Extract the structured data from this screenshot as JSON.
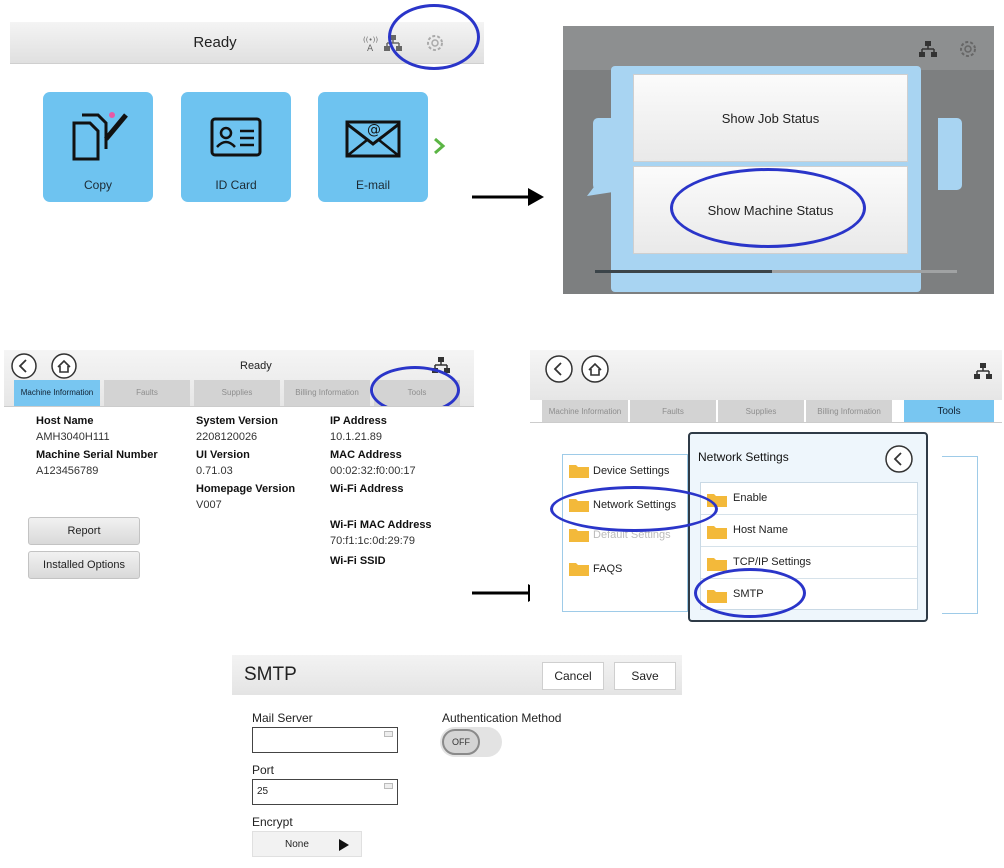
{
  "home": {
    "status": "Ready",
    "tiles": [
      {
        "label": "Copy",
        "icon": "copy-icon"
      },
      {
        "label": "ID Card",
        "icon": "id-card-icon"
      },
      {
        "label": "E-mail",
        "icon": "email-icon"
      }
    ],
    "icons": [
      "wireless-icon",
      "network-icon",
      "settings-gear-icon",
      "chevron-right-icon"
    ]
  },
  "status_menu": {
    "items": [
      "Show Job Status",
      "Show Machine Status"
    ],
    "progress": 0.49
  },
  "machine_info": {
    "status": "Ready",
    "tabs": [
      "Machine Information",
      "Faults",
      "Supplies",
      "Billing Information",
      "Tools"
    ],
    "host_name_label": "Host Name",
    "host_name": "AMH3040H111",
    "serial_label": "Machine Serial Number",
    "serial": "A123456789",
    "system_version_label": "System Version",
    "system_version": "2208120026",
    "ui_version_label": "UI Version",
    "ui_version": "0.71.03",
    "homepage_version_label": "Homepage Version",
    "homepage_version": "V007",
    "ip_label": "IP Address",
    "ip": "10.1.21.89",
    "mac_label": "MAC Address",
    "mac": "00:02:32:f0:00:17",
    "wifi_label": "Wi-Fi Address",
    "wifi_mac_label": "Wi-Fi MAC Address",
    "wifi_mac": "70:f1:1c:0d:29:79",
    "wifi_ssid_label": "Wi-Fi SSID",
    "report_button": "Report",
    "installed_options_button": "Installed Options"
  },
  "tools": {
    "tabs": [
      "Machine Information",
      "Faults",
      "Supplies",
      "Billing Information",
      "Tools"
    ],
    "list": [
      "Device Settings",
      "Network Settings",
      "Default Settings",
      "FAQS"
    ],
    "dialog_title": "Network Settings",
    "dialog_items": [
      "Enable",
      "Host Name",
      "TCP/IP Settings",
      "SMTP"
    ]
  },
  "smtp": {
    "title": "SMTP",
    "cancel": "Cancel",
    "save": "Save",
    "mail_server_label": "Mail Server",
    "mail_server_value": "",
    "auth_label": "Authentication Method",
    "auth_toggle": "OFF",
    "port_label": "Port",
    "port_value": "25",
    "encrypt_label": "Encrypt",
    "encrypt_value": "None"
  },
  "colors": {
    "tile_blue": "#6ec3f0",
    "tab_active": "#78c6f1",
    "highlight_circle": "#2a35c9",
    "popup_bg": "#7d7f80"
  }
}
